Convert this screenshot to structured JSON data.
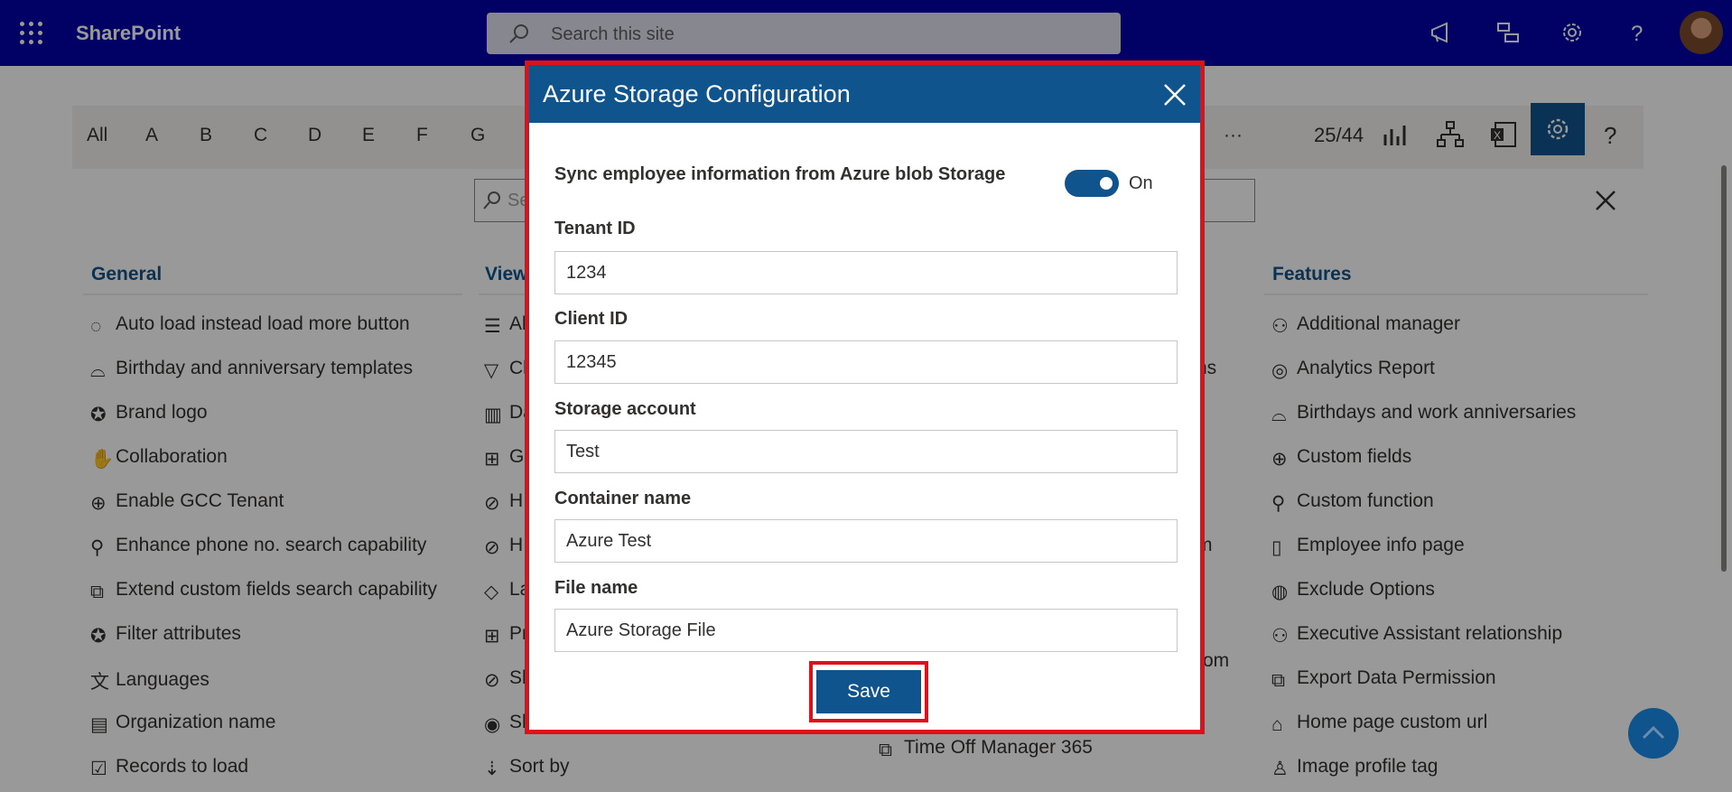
{
  "suitebar": {
    "brand": "SharePoint",
    "search_placeholder": "Search this site",
    "icons": [
      "waffle-icon",
      "megaphone-icon",
      "teams-chat-icon",
      "gear-icon",
      "help-icon"
    ]
  },
  "toolbar": {
    "letters": [
      "All",
      "A",
      "B",
      "C",
      "D",
      "E",
      "F",
      "G"
    ],
    "more": "···",
    "count": "25/44",
    "icons": [
      "chart-icon",
      "org-chart-icon",
      "excel-icon",
      "gear-icon",
      "help-icon"
    ],
    "filter_placeholder": "Se"
  },
  "columns": {
    "general": {
      "title": "General",
      "items": [
        "Auto load instead load more button",
        "Birthday and anniversary templates",
        "Brand logo",
        "Collaboration",
        "Enable GCC Tenant",
        "Enhance phone no. search capability",
        "Extend custom fields search capability",
        "Filter attributes",
        "Languages",
        "Organization name",
        "Records to load"
      ]
    },
    "view": {
      "title": "View",
      "items": [
        "Al",
        "Cl",
        "Da",
        "Gr",
        "H",
        "H",
        "La",
        "Pr",
        "Sh",
        "Sh",
        "Sort by"
      ]
    },
    "middle_fragments": [
      "ns",
      "m",
      "rom",
      "Time Off Manager 365"
    ],
    "features": {
      "title": "Features",
      "items": [
        "Additional manager",
        "Analytics Report",
        "Birthdays and work anniversaries",
        "Custom fields",
        "Custom function",
        "Employee info page",
        "Exclude Options",
        "Executive Assistant relationship",
        "Export Data Permission",
        "Home page custom url",
        "Image profile tag"
      ]
    }
  },
  "modal": {
    "title": "Azure Storage Configuration",
    "sync_label": "Sync employee information from Azure blob Storage",
    "toggle_state": "On",
    "fields": [
      {
        "label": "Tenant ID",
        "value": "1234"
      },
      {
        "label": "Client ID",
        "value": "12345"
      },
      {
        "label": "Storage account",
        "value": "Test"
      },
      {
        "label": "Container name",
        "value": "Azure Test"
      },
      {
        "label": "File name",
        "value": "Azure Storage File"
      }
    ],
    "save_label": "Save"
  },
  "colors": {
    "suitebar": "#0000a8",
    "accent": "#0f548c",
    "highlight": "#e0101b"
  }
}
